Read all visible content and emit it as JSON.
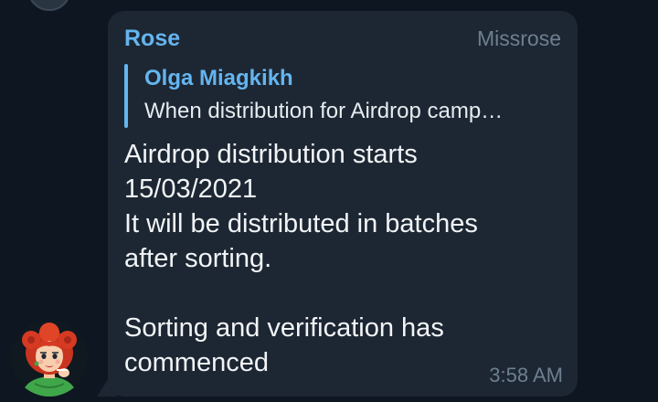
{
  "message": {
    "sender_name": "Rose",
    "sender_title": "Missrose",
    "reply": {
      "author": "Olga Miagkikh",
      "text": "When distribution for Airdrop camp…"
    },
    "body_lines": [
      "Airdrop distribution starts",
      "15/03/2021",
      "It will be distributed in batches",
      "after sorting.",
      "",
      "Sorting and verification has",
      "commenced"
    ],
    "time": "3:58 AM"
  },
  "avatar": {
    "icon": "cartoon-woman-avatar-icon"
  },
  "colors": {
    "background": "#0e1621",
    "bubble": "#1d2733",
    "accent": "#64b5ef",
    "muted": "#6d7f8f",
    "text": "#f2f5f7"
  }
}
